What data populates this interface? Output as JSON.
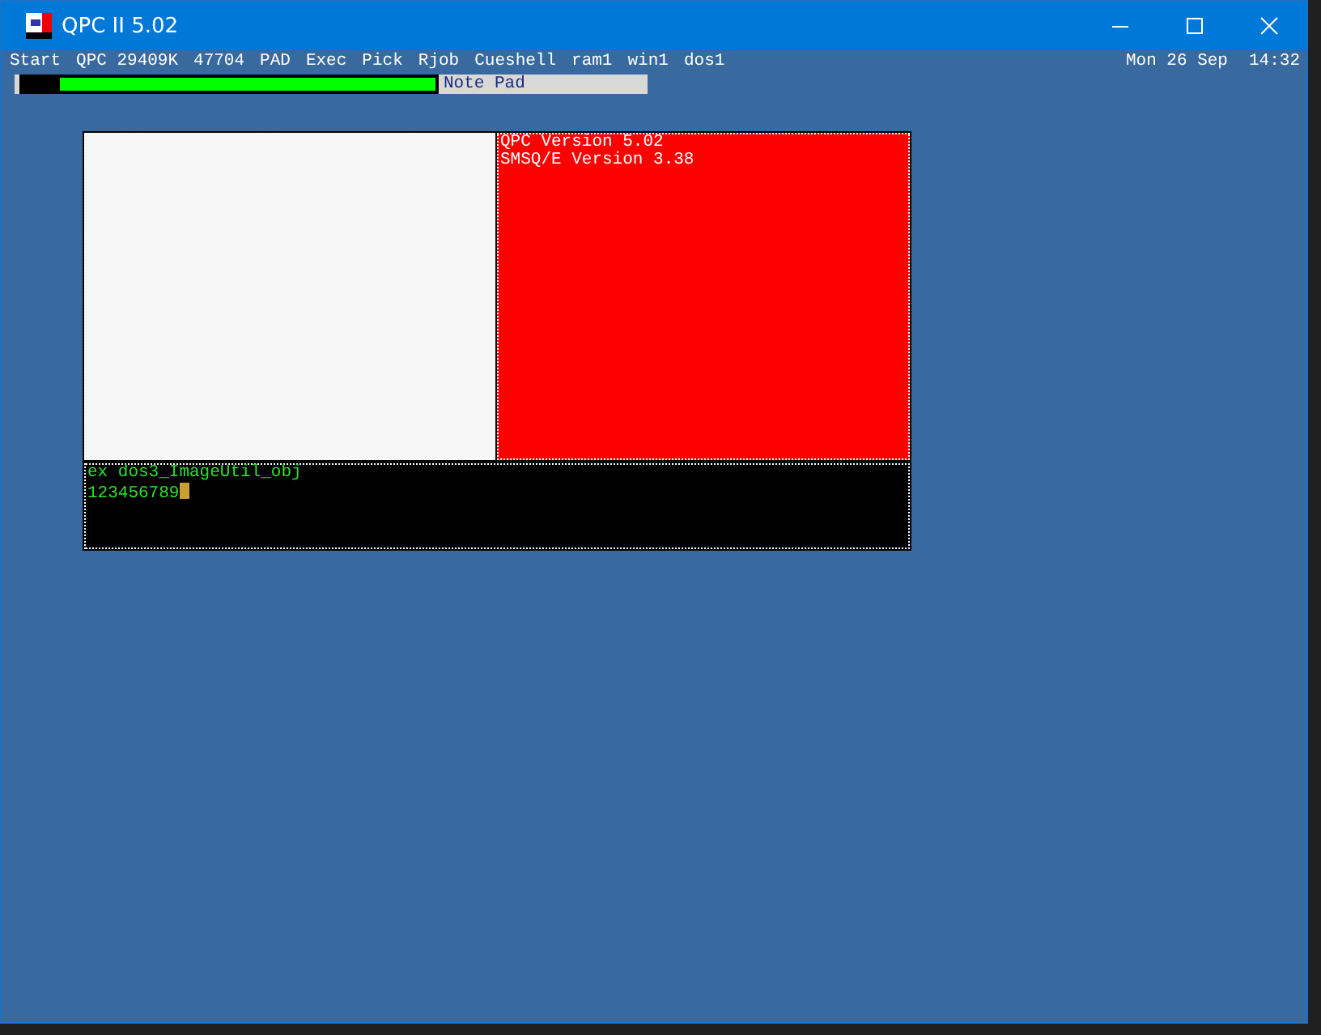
{
  "window": {
    "title": "QPC II 5.02"
  },
  "menu_bar": {
    "items": [
      "Start",
      "QPC 29409K",
      "47704",
      "PAD",
      "Exec",
      "Pick",
      "Rjob",
      "Cueshell",
      "ram1",
      "win1",
      "dos1"
    ],
    "date": "Mon 26 Sep",
    "time": "14:32"
  },
  "button_frame": {
    "label": "Note Pad",
    "level": 0.91
  },
  "info_window": {
    "lines": [
      "QPC Version 5.02",
      "SMSQ/E Version 3.38"
    ]
  },
  "console": {
    "lines": [
      "ex dos3_ImageUtil_obj",
      "123456789"
    ]
  }
}
